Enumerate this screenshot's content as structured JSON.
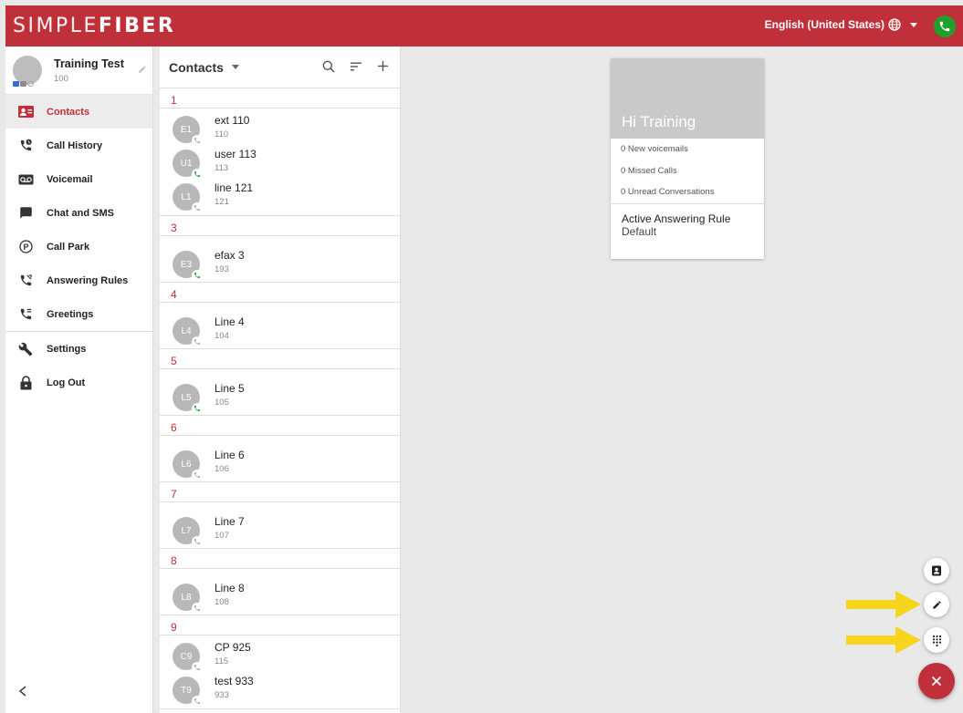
{
  "brand": {
    "logo_part1": "SIMPLE",
    "logo_part2": "FIBER",
    "primary_color": "#c0303a"
  },
  "header": {
    "language": "English (United States)",
    "phone_status_color": "#1fa02b"
  },
  "user": {
    "name": "Training Test",
    "extension": "100"
  },
  "sidebar": {
    "items": [
      {
        "label": "Contacts",
        "icon": "contacts-icon",
        "active": true
      },
      {
        "label": "Call History",
        "icon": "call-history-icon"
      },
      {
        "label": "Voicemail",
        "icon": "voicemail-icon"
      },
      {
        "label": "Chat and SMS",
        "icon": "chat-icon"
      },
      {
        "label": "Call Park",
        "icon": "call-park-icon"
      },
      {
        "label": "Answering Rules",
        "icon": "answering-rules-icon"
      },
      {
        "label": "Greetings",
        "icon": "greetings-icon"
      },
      {
        "label": "Settings",
        "icon": "settings-icon"
      },
      {
        "label": "Log Out",
        "icon": "lock-icon"
      }
    ]
  },
  "contacts": {
    "title": "Contacts",
    "groups": [
      {
        "letter": "1",
        "items": [
          {
            "initials": "E1",
            "name": "ext 110",
            "ext": "110",
            "online": false
          },
          {
            "initials": "U1",
            "name": "user 113",
            "ext": "113",
            "online": true
          },
          {
            "initials": "L1",
            "name": "line 121",
            "ext": "121",
            "online": false
          }
        ]
      },
      {
        "letter": "3",
        "items": [
          {
            "initials": "E3",
            "name": "efax 3",
            "ext": "193",
            "online": true
          }
        ]
      },
      {
        "letter": "4",
        "items": [
          {
            "initials": "L4",
            "name": "Line 4",
            "ext": "104",
            "online": false
          }
        ]
      },
      {
        "letter": "5",
        "items": [
          {
            "initials": "L5",
            "name": "Line 5",
            "ext": "105",
            "online": true
          }
        ]
      },
      {
        "letter": "6",
        "items": [
          {
            "initials": "L6",
            "name": "Line 6",
            "ext": "106",
            "online": false
          }
        ]
      },
      {
        "letter": "7",
        "items": [
          {
            "initials": "L7",
            "name": "Line 7",
            "ext": "107",
            "online": false
          }
        ]
      },
      {
        "letter": "8",
        "items": [
          {
            "initials": "L8",
            "name": "Line 8",
            "ext": "108",
            "online": false
          }
        ]
      },
      {
        "letter": "9",
        "items": [
          {
            "initials": "C9",
            "name": "CP 925",
            "ext": "115",
            "online": false
          },
          {
            "initials": "T9",
            "name": "test 933",
            "ext": "933",
            "online": false
          }
        ]
      }
    ]
  },
  "summary": {
    "greeting": "Hi Training",
    "new_voicemails": "0 New voicemails",
    "missed_calls": "0 Missed Calls",
    "unread_conversations": "0 Unread Conversations",
    "answering_rule_title": "Active Answering Rule",
    "answering_rule_value": "Default"
  },
  "annotation_color": "#f7d51d"
}
